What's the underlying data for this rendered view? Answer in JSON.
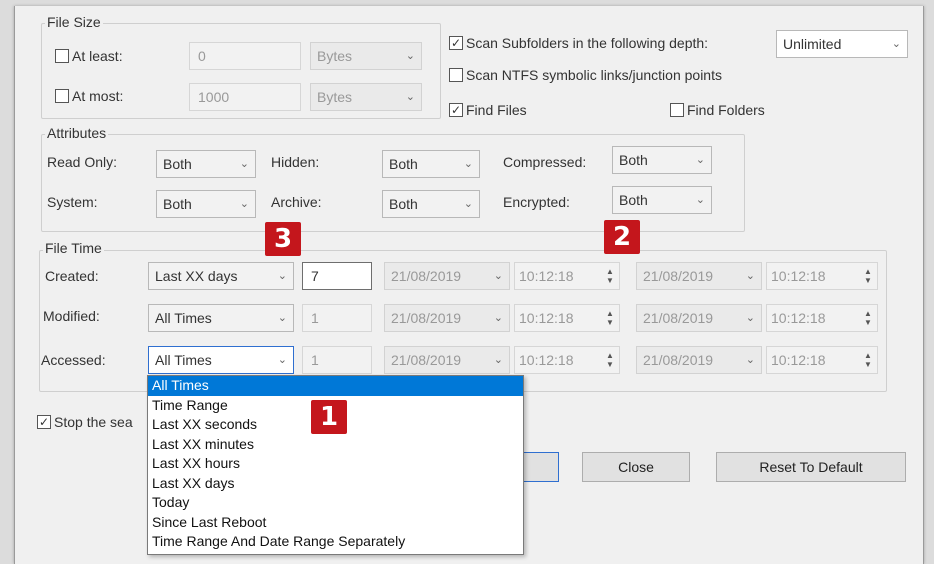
{
  "file_size": {
    "title": "File Size",
    "at_least": {
      "label": "At least:",
      "value": "0",
      "unit": "Bytes"
    },
    "at_most": {
      "label": "At most:",
      "value": "1000",
      "unit": "Bytes"
    }
  },
  "scan": {
    "subfolders_label": "Scan Subfolders in the following depth:",
    "depth_value": "Unlimited",
    "ntfs_label": "Scan NTFS symbolic links/junction points",
    "find_files_label": "Find Files",
    "find_folders_label": "Find Folders"
  },
  "attributes": {
    "title": "Attributes",
    "read_only": {
      "label": "Read Only:",
      "value": "Both"
    },
    "hidden": {
      "label": "Hidden:",
      "value": "Both"
    },
    "compressed": {
      "label": "Compressed:",
      "value": "Both"
    },
    "system": {
      "label": "System:",
      "value": "Both"
    },
    "archive": {
      "label": "Archive:",
      "value": "Both"
    },
    "encrypted": {
      "label": "Encrypted:",
      "value": "Both"
    }
  },
  "file_time": {
    "title": "File Time",
    "created": {
      "label": "Created:",
      "mode": "Last XX days",
      "count": "7",
      "date1": "21/08/2019",
      "time1": "10:12:18",
      "date2": "21/08/2019",
      "time2": "10:12:18"
    },
    "modified": {
      "label": "Modified:",
      "mode": "All Times",
      "count": "1",
      "date1": "21/08/2019",
      "time1": "10:12:18",
      "date2": "21/08/2019",
      "time2": "10:12:18"
    },
    "accessed": {
      "label": "Accessed:",
      "mode": "All Times",
      "count": "1",
      "date1": "21/08/2019",
      "time1": "10:12:18",
      "date2": "21/08/2019",
      "time2": "10:12:18"
    }
  },
  "stop_label": "Stop the sea",
  "buttons": {
    "ok": "",
    "close": "Close",
    "reset": "Reset To Default"
  },
  "dropdown_options": [
    "All Times",
    "Time Range",
    "Last XX seconds",
    "Last XX minutes",
    "Last XX hours",
    "Last XX days",
    "Today",
    "Since Last Reboot",
    "Time Range And Date Range Separately"
  ],
  "badges": [
    "1",
    "2",
    "3"
  ],
  "colors": {
    "badge": "#c4161c",
    "selection": "#0078d7"
  }
}
